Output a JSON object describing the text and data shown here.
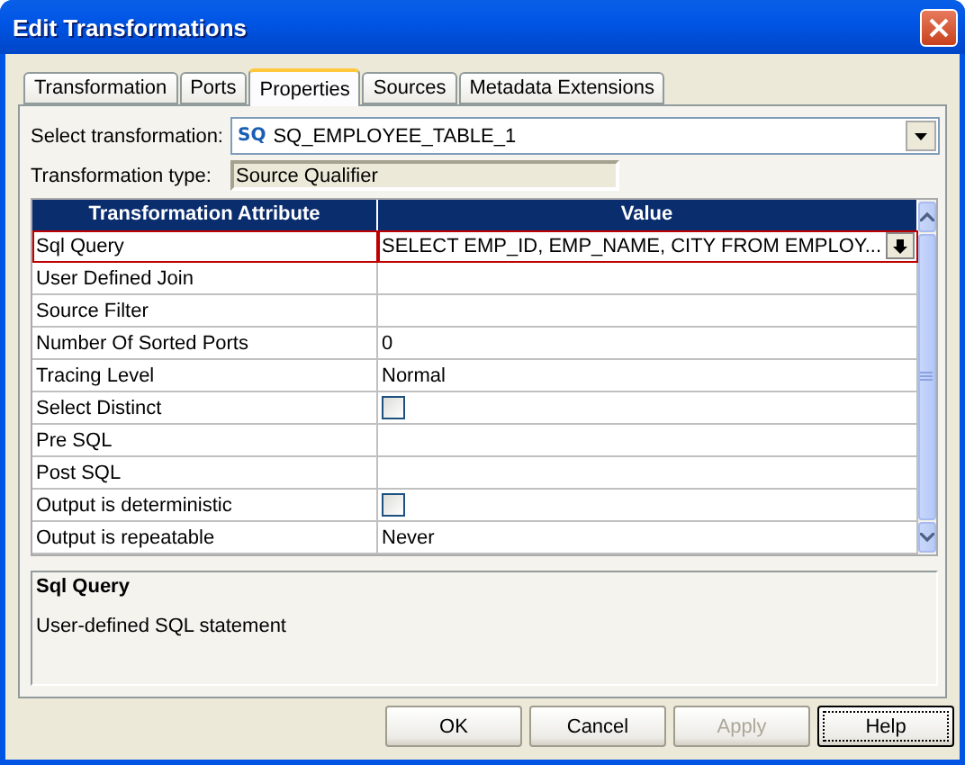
{
  "window": {
    "title": "Edit Transformations"
  },
  "tabs": [
    {
      "label": "Transformation",
      "selected": false
    },
    {
      "label": "Ports",
      "selected": false
    },
    {
      "label": "Properties",
      "selected": true
    },
    {
      "label": "Sources",
      "selected": false
    },
    {
      "label": "Metadata Extensions",
      "selected": false
    }
  ],
  "select_transformation": {
    "label": "Select transformation:",
    "icon_text": "SQ",
    "value": "SQ_EMPLOYEE_TABLE_1"
  },
  "transformation_type": {
    "label": "Transformation type:",
    "value": "Source Qualifier"
  },
  "table": {
    "columns": [
      "Transformation Attribute",
      "Value"
    ],
    "rows": [
      {
        "attribute": "Sql Query",
        "kind": "editor",
        "value": "SELECT EMP_ID, EMP_NAME, CITY FROM EMPLOY...",
        "selected": true
      },
      {
        "attribute": "User Defined Join",
        "kind": "text",
        "selected": false
      },
      {
        "attribute": "Source Filter",
        "kind": "text",
        "selected": false
      },
      {
        "attribute": "Number Of Sorted Ports",
        "kind": "text",
        "value": "0",
        "selected": false
      },
      {
        "attribute": "Tracing Level",
        "kind": "text",
        "value": "Normal",
        "selected": false
      },
      {
        "attribute": "Select Distinct",
        "kind": "checkbox",
        "checked": false,
        "selected": false
      },
      {
        "attribute": "Pre SQL",
        "kind": "text",
        "selected": false
      },
      {
        "attribute": "Post SQL",
        "kind": "text",
        "selected": false
      },
      {
        "attribute": "Output is deterministic",
        "kind": "checkbox",
        "checked": false,
        "selected": false
      },
      {
        "attribute": "Output is repeatable",
        "kind": "text",
        "value": "Never",
        "selected": false
      }
    ]
  },
  "description": {
    "title": "Sql Query",
    "text": "User-defined SQL statement"
  },
  "buttons": [
    {
      "label": "OK",
      "disabled": false,
      "focused": false
    },
    {
      "label": "Cancel",
      "disabled": false,
      "focused": false
    },
    {
      "label": "Apply",
      "disabled": true,
      "focused": false
    },
    {
      "label": "Help",
      "disabled": false,
      "focused": true
    }
  ]
}
